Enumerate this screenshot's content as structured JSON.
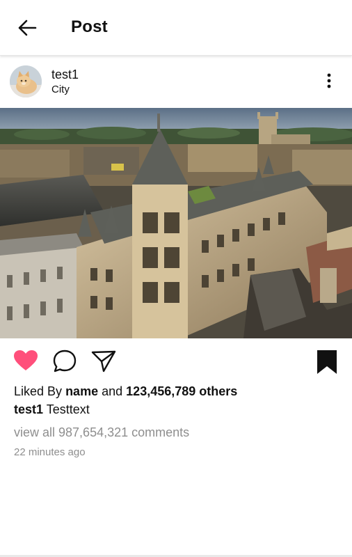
{
  "header": {
    "title": "Post",
    "back_icon": "arrow-left-icon"
  },
  "post": {
    "username": "test1",
    "location": "City",
    "avatar_icon": "cat-avatar",
    "more_icon": "more-vertical-icon",
    "image_description_icon": "city-photo"
  },
  "actions": {
    "like_icon": "heart-icon",
    "like_color": "#ff4f7b",
    "comment_icon": "comment-icon",
    "share_icon": "send-icon",
    "save_icon": "bookmark-icon"
  },
  "likes": {
    "prefix": "Liked By",
    "name": "name",
    "connector": "and",
    "others": "123,456,789 others"
  },
  "caption": {
    "username": "test1",
    "text": "Testtext"
  },
  "comments_link": "view all 987,654,321 comments",
  "timestamp": "22 minutes ago"
}
